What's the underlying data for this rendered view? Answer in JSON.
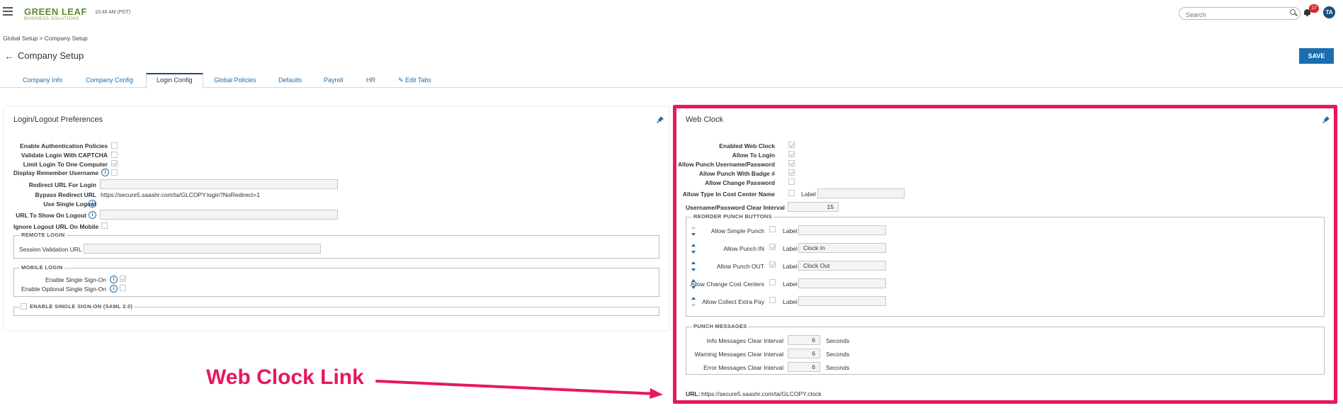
{
  "header": {
    "logo_main": "GREEN LEAF",
    "logo_sub": "BUSINESS SOLUTIONS",
    "time": "10:46 AM (PDT)",
    "search_placeholder": "Search",
    "notification_count": "17",
    "avatar_initials": "TA"
  },
  "breadcrumb": "Global Setup > Company Setup",
  "page_title": "Company Setup",
  "save_label": "SAVE",
  "tabs": [
    {
      "label": "Company Info"
    },
    {
      "label": "Company Config"
    },
    {
      "label": "Login Config"
    },
    {
      "label": "Global Policies"
    },
    {
      "label": "Defaults"
    },
    {
      "label": "Payroll"
    },
    {
      "label": "HR"
    },
    {
      "label": "Edit Tabs"
    }
  ],
  "active_tab": "Login Config",
  "login_panel": {
    "title": "Login/Logout Preferences",
    "fields": {
      "enable_auth_policies": "Enable Authentication Policies",
      "validate_captcha": "Validate Login With CAPTCHA",
      "limit_one_computer": "Limit Login To One Computer",
      "display_remember": "Display Remember Username",
      "redirect_url_login": "Redirect URL For Login",
      "bypass_redirect": "Bypass Redirect URL",
      "bypass_redirect_value": "https://secure5.saashr.com/ta/GLCOPY.login?NoRedirect=1",
      "use_single_logout": "Use Single Logout",
      "url_on_logout": "URL To Show On Logout",
      "ignore_logout_mobile": "Ignore Logout URL On Mobile"
    },
    "remote_login": {
      "legend": "REMOTE LOGIN",
      "session_validation": "Session Validation URL"
    },
    "mobile_login": {
      "legend": "MOBILE LOGIN",
      "enable_sso": "Enable Single Sign-On",
      "enable_optional_sso": "Enable Optional Single Sign-On"
    },
    "saml": {
      "legend": "ENABLE SINGLE SIGN-ON (SAML 2.0)"
    }
  },
  "webclock_panel": {
    "title": "Web Clock",
    "fields": {
      "enabled_web_clock": "Enabled Web Clock",
      "allow_to_login": "Allow To Login",
      "allow_punch_userpass": "Allow Punch Username/Password",
      "allow_punch_badge": "Allow Punch With Badge #",
      "allow_change_password": "Allow Change Password",
      "allow_type_cost_center": "Allow Type In Cost Center Name",
      "label_text": "Label",
      "clear_interval": "Username/Password Clear Interval",
      "clear_interval_value": "15"
    },
    "reorder": {
      "legend": "REORDER PUNCH BUTTONS",
      "label_text": "Label",
      "rows": [
        {
          "name": "Allow Simple Punch",
          "checked": false,
          "label_value": ""
        },
        {
          "name": "Allow Punch IN",
          "checked": true,
          "label_value": "Clock In"
        },
        {
          "name": "Allow Punch OUT",
          "checked": true,
          "label_value": "Clock Out"
        },
        {
          "name": "Allow Change Cost Centers",
          "checked": false,
          "label_value": ""
        },
        {
          "name": "Allow Collect Extra Pay",
          "checked": false,
          "label_value": ""
        }
      ]
    },
    "punch_messages": {
      "legend": "PUNCH MESSAGES",
      "unit": "Seconds",
      "rows": [
        {
          "name": "Info Messages Clear Interval",
          "value": "6"
        },
        {
          "name": "Warning Messages Clear Interval",
          "value": "6"
        },
        {
          "name": "Error Messages Clear Interval",
          "value": "6"
        }
      ]
    },
    "url_label": "URL:",
    "url_value": "https://secure5.saashr.com/ta/GLCOPY.clock"
  },
  "annotation": {
    "text": "Web Clock Link",
    "color": "#e8185a"
  },
  "colors": {
    "primary": "#1a6db0",
    "brand_green": "#5b8b2f",
    "notification": "#d9272e"
  }
}
